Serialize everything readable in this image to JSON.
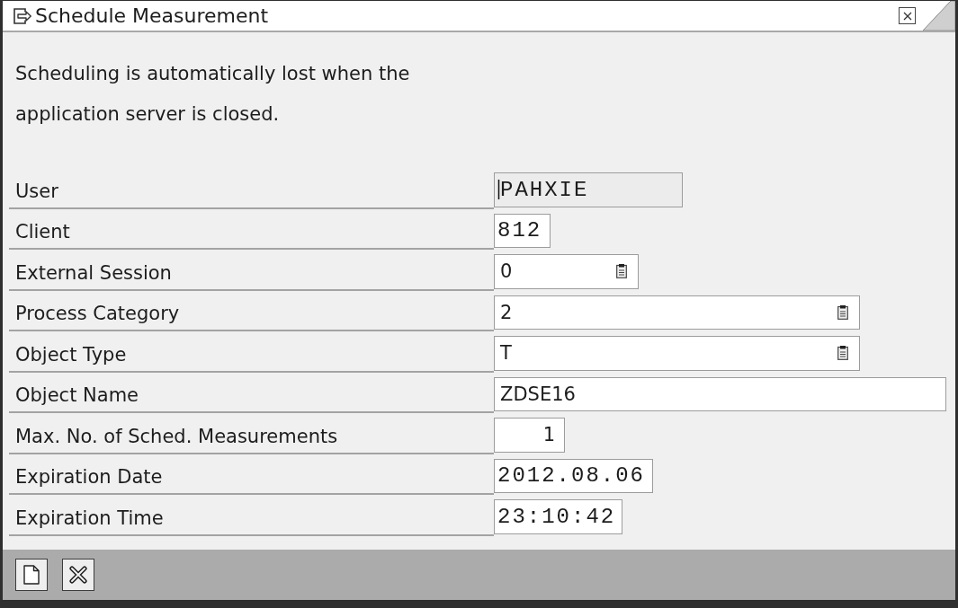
{
  "window": {
    "title": "Schedule Measurement"
  },
  "message": "Scheduling is automatically lost when the application server is closed.",
  "fields": [
    {
      "label": "User",
      "value": "PAHXIE",
      "kind": "display",
      "value_help": false,
      "focused": true
    },
    {
      "label": "Client",
      "value": "812",
      "kind": "code",
      "value_help": false,
      "focused": false
    },
    {
      "label": "External Session",
      "value": "0",
      "kind": "text",
      "value_help": true,
      "focused": false
    },
    {
      "label": "Process Category",
      "value": "2",
      "kind": "text",
      "value_help": true,
      "focused": false
    },
    {
      "label": "Object Type",
      "value": "T",
      "kind": "text",
      "value_help": true,
      "focused": false
    },
    {
      "label": "Object Name",
      "value": "ZDSE16",
      "kind": "text",
      "value_help": false,
      "focused": false
    },
    {
      "label": "Max. No. of Sched. Measurements",
      "value": "1",
      "kind": "count",
      "value_help": false,
      "focused": false
    },
    {
      "label": "Expiration Date",
      "value": "2012.08.06",
      "kind": "date",
      "value_help": false,
      "focused": false
    },
    {
      "label": "Expiration Time",
      "value": "23:10:42",
      "kind": "time",
      "value_help": false,
      "focused": false
    }
  ],
  "toolbar": {
    "buttons": [
      {
        "kind": "new"
      },
      {
        "kind": "cancel"
      }
    ]
  }
}
